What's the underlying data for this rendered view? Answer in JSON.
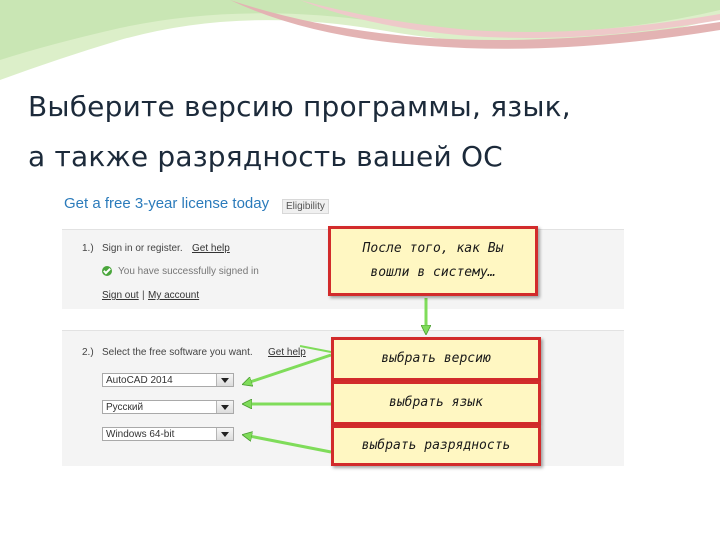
{
  "slide": {
    "title_line1": "Выберите версию программы, язык,",
    "title_line2": "а также разрядность вашей ОС"
  },
  "screenshot": {
    "license_title": "Get a free 3-year license today",
    "eligibility": "Eligibility",
    "step1": {
      "number": "1.)",
      "sign_in": "Sign in or register.",
      "get_help": "Get help",
      "success": "You have successfully signed in",
      "sign_out": "Sign out",
      "separator": "|",
      "my_account": "My account",
      "success_icon": "check-circle-icon"
    },
    "step2": {
      "number": "2.)",
      "instruction": "Select the free software you want.",
      "get_help": "Get help",
      "version": "AutoCAD 2014",
      "language": "Русский",
      "bitness": "Windows 64-bit"
    }
  },
  "callouts": {
    "heading_line1": "После того, как Вы",
    "heading_line2": "вошли в систему…",
    "version": "выбрать версию",
    "language": "выбрать язык",
    "bitness": "выбрать разрядность"
  },
  "colors": {
    "title_text": "#1c2a3a",
    "link_blue": "#2b7bbb",
    "callout_border": "#d22b2b",
    "callout_fill": "#fff7c2",
    "arrow_green": "#7fdc5a",
    "banner_green": "#c9e6b4",
    "banner_pink": "#e3b3b3"
  }
}
